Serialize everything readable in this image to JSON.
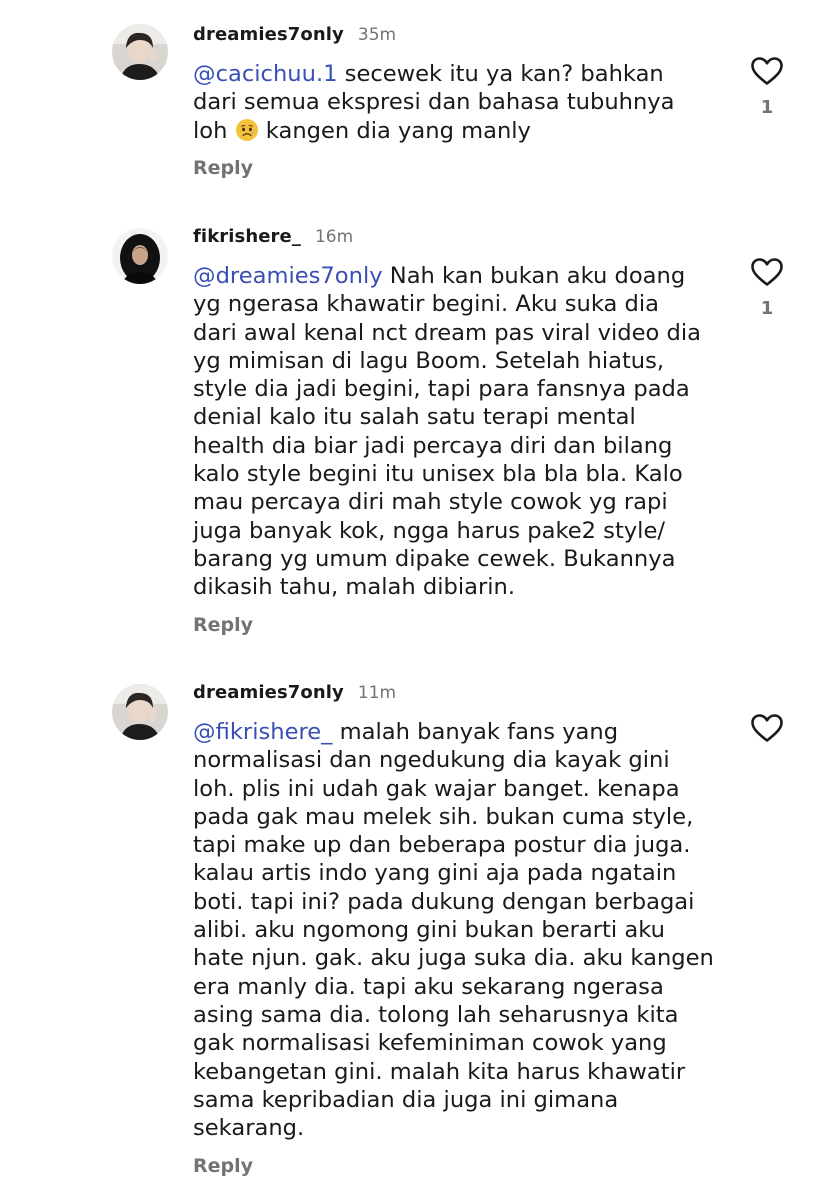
{
  "comments": [
    {
      "username": "dreamies7only",
      "time": "35m",
      "mention": "@cacichuu.1",
      "lines": [
        " secewek itu ya kan? bahkan",
        "dari semua ekspresi dan bahasa tubuhnya",
        "loh",
        " kangen dia yang manly"
      ],
      "emoji": "worried-face-emoji",
      "reply_label": "Reply",
      "like_count": "1",
      "like_icon": "heart-outline-icon"
    },
    {
      "username": "fikrishere_",
      "time": "16m",
      "mention": "@dreamies7only",
      "lines": [
        " Nah kan bukan aku doang",
        "yg ngerasa khawatir begini. Aku suka dia",
        "dari awal kenal nct dream pas viral video dia",
        "yg mimisan di lagu Boom. Setelah hiatus,",
        "style dia jadi begini, tapi para fansnya pada",
        "denial kalo itu salah satu terapi mental",
        "health dia biar jadi percaya diri dan bilang",
        "kalo style begini itu unisex bla bla bla. Kalo",
        "mau percaya diri mah style cowok yg rapi",
        "juga banyak kok, ngga harus pake2 style/",
        "barang yg umum dipake cewek. Bukannya",
        "dikasih tahu, malah dibiarin."
      ],
      "reply_label": "Reply",
      "like_count": "1",
      "like_icon": "heart-outline-icon"
    },
    {
      "username": "dreamies7only",
      "time": "11m",
      "mention": "@fikrishere_",
      "lines": [
        " malah banyak fans yang",
        "normalisasi dan ngedukung dia kayak gini",
        "loh. plis ini udah gak wajar banget. kenapa",
        "pada gak mau melek sih. bukan cuma style,",
        "tapi make up dan beberapa postur dia juga.",
        "kalau artis indo yang gini aja pada ngatain",
        "boti. tapi ini? pada dukung dengan berbagai",
        "alibi. aku ngomong gini bukan berarti aku",
        "hate njun. gak. aku juga suka dia. aku kangen",
        "era manly dia. tapi aku sekarang ngerasa",
        "asing sama dia. tolong lah seharusnya kita",
        "gak normalisasi kefeminiman cowok yang",
        "kebangetan gini. malah kita harus khawatir",
        "sama kepribadian dia juga ini gimana",
        "sekarang."
      ],
      "reply_label": "Reply",
      "like_icon": "heart-outline-icon"
    }
  ],
  "colors": {
    "text": "#1a1a1a",
    "muted": "#737373",
    "mention": "#3a4fb5"
  }
}
